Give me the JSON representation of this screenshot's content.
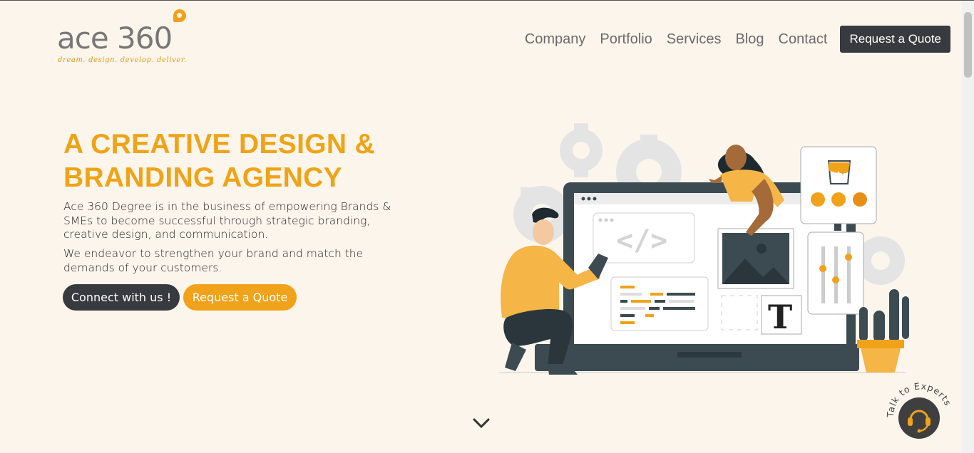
{
  "logo": {
    "text": "ace 360",
    "tagline": "dream. design. develop. deliver."
  },
  "nav": {
    "items": [
      "Company",
      "Portfolio",
      "Services",
      "Blog",
      "Contact"
    ],
    "quote_label": "Request a Quote"
  },
  "hero": {
    "title": "A CREATIVE DESIGN & BRANDING AGENCY",
    "paragraph1": "Ace 360 Degree is in the business of empowering Brands & SMEs to become successful through strategic branding, creative design, and communication.",
    "paragraph2": "We endeavor to strengthen your brand and match the demands of your customers.",
    "connect_label": "Connect with us !",
    "quote_label": "Request a Quote"
  },
  "illustration": {
    "letter": "T",
    "code_glyph": "</>"
  },
  "talk_widget": {
    "label": "Talk to Experts"
  },
  "colors": {
    "brand": "#f0a21a",
    "dark": "#373a3f",
    "background": "#fcf5ec"
  },
  "icons": [
    "chevron-down-icon",
    "headset-icon"
  ]
}
